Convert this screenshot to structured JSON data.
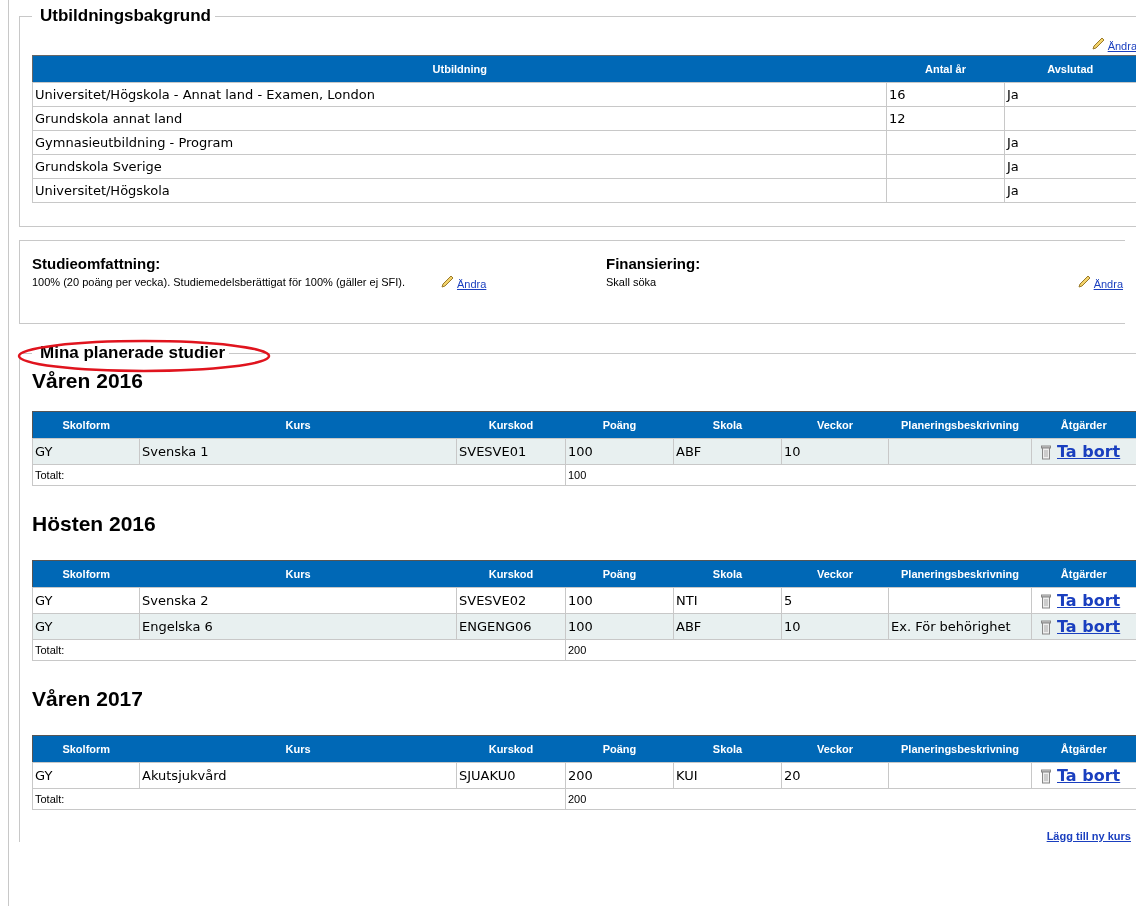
{
  "education": {
    "legend": "Utbildningsbakgrund",
    "edit_link": "Ändra",
    "columns": [
      "Utbildning",
      "Antal år",
      "Avslutad"
    ],
    "rows": [
      [
        "Universitet/Högskola - Annat land - Examen, London",
        "16",
        "Ja"
      ],
      [
        "Grundskola annat land",
        "12",
        ""
      ],
      [
        "Gymnasieutbildning - Program",
        "",
        "Ja"
      ],
      [
        "Grundskola Sverige",
        "",
        "Ja"
      ],
      [
        "Universitet/Högskola",
        "",
        "Ja"
      ]
    ]
  },
  "scope": {
    "title": "Studieomfattning:",
    "text": "100% (20 poäng per vecka). Studiemedelsberättigat för 100% (gäller ej SFI).",
    "edit_link": "Ändra"
  },
  "financing": {
    "title": "Finansiering:",
    "text": "Skall söka",
    "edit_link": "Ändra"
  },
  "planned": {
    "legend": "Mina planerade studier",
    "terms": [
      {
        "title": "Våren 2016",
        "columns": [
          "Skolform",
          "Kurs",
          "Kurskod",
          "Poäng",
          "Skola",
          "Veckor",
          "Planeringsbeskrivning",
          "Åtgärder"
        ],
        "rows": [
          {
            "cells": [
              "GY",
              "Svenska 1",
              "SVESVE01",
              "100",
              "ABF",
              "10",
              ""
            ],
            "shaded": true,
            "action": "Ta bort"
          }
        ],
        "total_label": "Totalt:",
        "total": "100"
      },
      {
        "title": "Hösten 2016",
        "columns": [
          "Skolform",
          "Kurs",
          "Kurskod",
          "Poäng",
          "Skola",
          "Veckor",
          "Planeringsbeskrivning",
          "Åtgärder"
        ],
        "rows": [
          {
            "cells": [
              "GY",
              "Svenska 2",
              "SVESVE02",
              "100",
              "NTI",
              "5",
              ""
            ],
            "shaded": false,
            "action": "Ta bort"
          },
          {
            "cells": [
              "GY",
              "Engelska 6",
              "ENGENG06",
              "100",
              "ABF",
              "10",
              "Ex. För behörighet"
            ],
            "shaded": true,
            "action": "Ta bort"
          }
        ],
        "total_label": "Totalt:",
        "total": "200"
      },
      {
        "title": "Våren 2017",
        "columns": [
          "Skolform",
          "Kurs",
          "Kurskod",
          "Poäng",
          "Skola",
          "Veckor",
          "Planeringsbeskrivning",
          "Åtgärder"
        ],
        "rows": [
          {
            "cells": [
              "GY",
              "Akutsjukvård",
              "SJUAKU0",
              "200",
              "KUI",
              "20",
              ""
            ],
            "shaded": false,
            "action": "Ta bort"
          }
        ],
        "total_label": "Totalt:",
        "total": "200"
      }
    ],
    "add_link": "Lägg till ny kurs"
  }
}
